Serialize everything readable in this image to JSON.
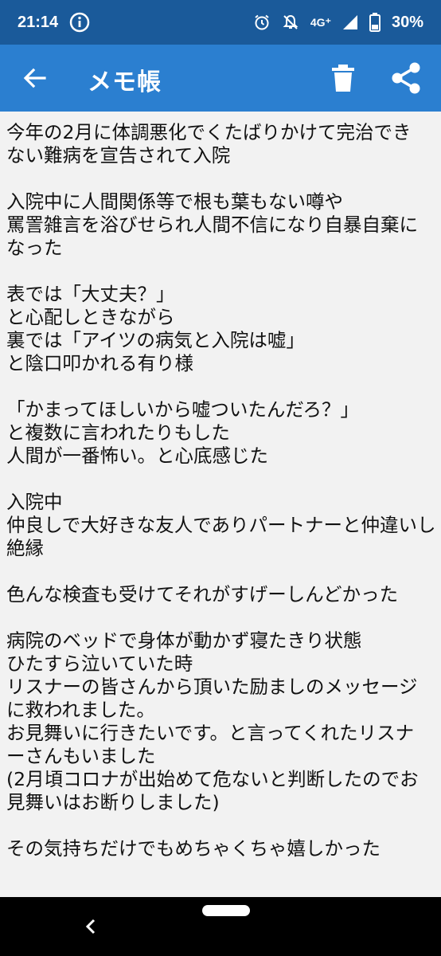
{
  "status_bar": {
    "time": "21:14",
    "network": "4G⁺",
    "battery": "30%",
    "colors": {
      "background": "#1a5a9a",
      "text": "#ffffff"
    }
  },
  "app_bar": {
    "title": "メモ帳",
    "back_icon": "arrow-left-icon",
    "delete_icon": "trash-icon",
    "share_icon": "share-icon",
    "colors": {
      "background": "#2b7fd0",
      "text": "#ffffff"
    }
  },
  "memo": {
    "lines": [
      "今年の2月に体調悪化でくたばりかけて完治でき",
      "ない難病を宣告されて入院",
      "",
      "入院中に人間関係等で根も葉もない噂や",
      "罵詈雑言を浴びせられ人間不信になり自暴自棄に",
      "なった",
      "",
      "表では「大丈夫？」",
      "と心配しときながら",
      "裏では「アイツの病気と入院は嘘」",
      "と陰口叩かれる有り様",
      "",
      "「かまってほしいから嘘ついたんだろ？」",
      "と複数に言われたりもした",
      "人間が一番怖い。と心底感じた",
      "",
      "入院中",
      "仲良しで大好きな友人でありパートナーと仲違いし",
      "絶縁",
      "",
      "色んな検査も受けてそれがすげーしんどかった",
      "",
      "病院のベッドで身体が動かず寝たきり状態",
      "ひたすら泣いていた時",
      "リスナーの皆さんから頂いた励ましのメッセージ",
      "に救われました。",
      "お見舞いに行きたいです。と言ってくれたリスナ",
      "ーさんもいました",
      "(2月頃コロナが出始めて危ないと判断したのでお",
      "見舞いはお断りしました)",
      "",
      "その気持ちだけでもめちゃくちゃ嬉しかった"
    ],
    "colors": {
      "background": "#f2f2f2",
      "text": "#111111"
    }
  },
  "nav_bar": {
    "back_icon": "chevron-left-icon",
    "home_icon": "home-pill-icon"
  }
}
